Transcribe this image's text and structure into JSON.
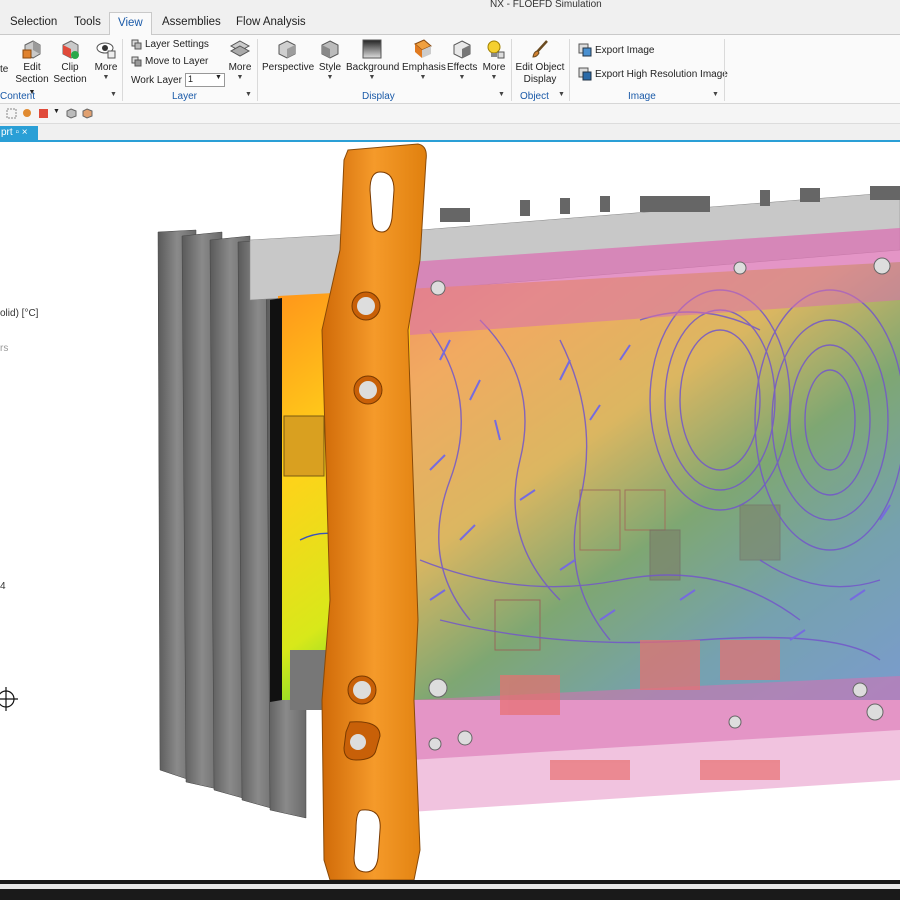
{
  "window": {
    "title": "NX - FLOEFD Simulation"
  },
  "menu_tabs": [
    {
      "label": "Selection"
    },
    {
      "label": "Tools"
    },
    {
      "label": "View"
    },
    {
      "label": "Assemblies"
    },
    {
      "label": "Flow Analysis"
    }
  ],
  "ribbon": {
    "content_group": {
      "label": "Content",
      "partial_label": "te",
      "edit_section": "Edit",
      "edit_section_2": "Section",
      "clip_section": "Clip",
      "clip_section_2": "Section",
      "more": "More"
    },
    "layer_group": {
      "label": "Layer",
      "layer_settings": "Layer Settings",
      "move_to_layer": "Move to Layer",
      "work_layer_label": "Work Layer",
      "work_layer_value": "1",
      "more": "More"
    },
    "display_group": {
      "label": "Display",
      "perspective": "Perspective",
      "style": "Style",
      "background": "Background",
      "emphasis": "Emphasis",
      "effects": "Effects",
      "more": "More"
    },
    "object_group": {
      "label": "Object",
      "edit_object_display": "Edit Object",
      "edit_object_display_2": "Display"
    },
    "image_group": {
      "label": "Image",
      "export_image": "Export Image",
      "export_high_res": "Export High Resolution Image"
    }
  },
  "document_tab": {
    "label": "prt",
    "close": "×"
  },
  "viewport": {
    "legend_partial_title": "olid) [°C]",
    "legend_partial_sub": "rs",
    "legend_partial_value": "4"
  },
  "colors": {
    "accent": "#1a5aa8",
    "doc_tab": "#2a9fd6",
    "bracket": "#f08a1e",
    "enclosure": "#e07ab8"
  }
}
